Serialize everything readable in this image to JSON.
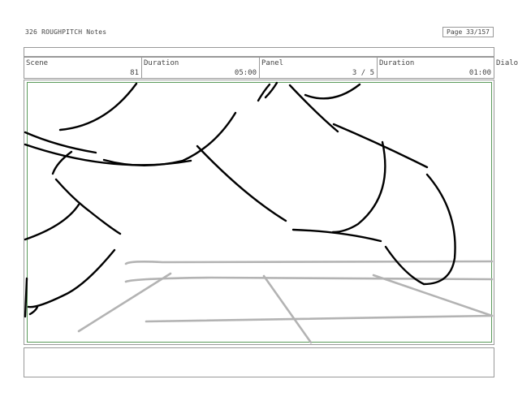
{
  "header": {
    "doc_title": "326 ROUGHPITCH Notes",
    "page_label": "Page 33/157"
  },
  "info": {
    "scene_label": "Scene",
    "scene_value": "81",
    "duration1_label": "Duration",
    "duration1_value": "05:00",
    "panel_label": "Panel",
    "panel_value": "3 / 5",
    "duration2_label": "Duration",
    "duration2_value": "01:00",
    "dialog_label": "Dialo"
  },
  "colors": {
    "frame_border": "#999999",
    "panel_border": "#5a9a5a",
    "sketch_dark": "#000000",
    "sketch_light": "#b3b3b3"
  }
}
